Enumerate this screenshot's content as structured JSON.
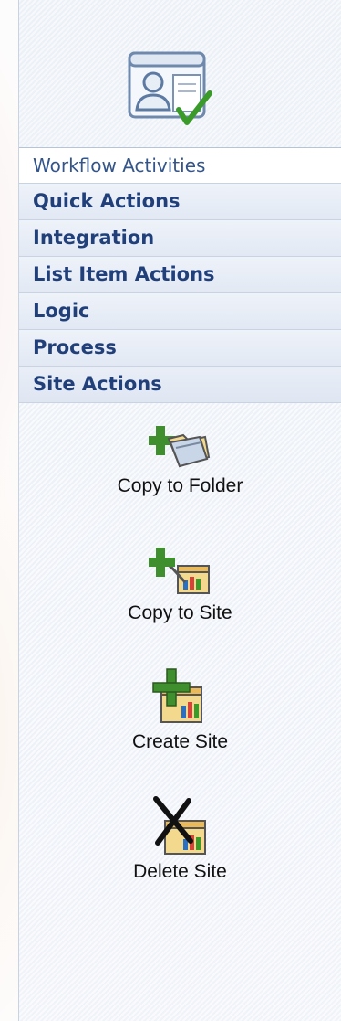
{
  "panel": {
    "header_icon": "workflow-user-document-check-icon",
    "gallery_title": "Workflow Activities"
  },
  "categories": [
    {
      "label": "Quick Actions"
    },
    {
      "label": "Integration"
    },
    {
      "label": "List Item Actions"
    },
    {
      "label": "Logic"
    },
    {
      "label": "Process"
    },
    {
      "label": "Site Actions"
    }
  ],
  "active_category": "Site Actions",
  "actions": [
    {
      "label": "Copy to Folder",
      "icon": "copy-to-folder-icon"
    },
    {
      "label": "Copy to Site",
      "icon": "copy-to-site-icon"
    },
    {
      "label": "Create Site",
      "icon": "create-site-icon"
    },
    {
      "label": "Delete Site",
      "icon": "delete-site-icon"
    }
  ],
  "colors": {
    "category_text": "#21407a",
    "header_text": "#33558a",
    "plus_green": "#3f8f2f",
    "checkmark_green": "#3a9a2a"
  }
}
